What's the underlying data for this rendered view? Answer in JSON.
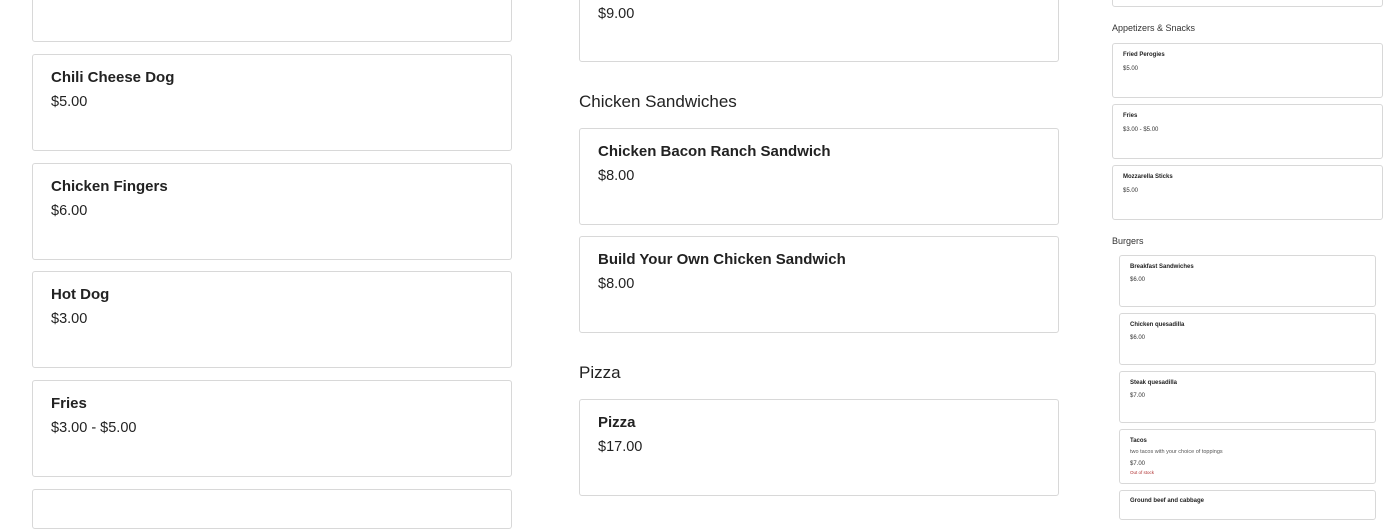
{
  "left_column": {
    "items": [
      {
        "name": "Chili Cheese Dog",
        "price": "$5.00"
      },
      {
        "name": "Chicken Fingers",
        "price": "$6.00"
      },
      {
        "name": "Hot Dog",
        "price": "$3.00"
      },
      {
        "name": "Fries",
        "price": "$3.00 - $5.00"
      }
    ]
  },
  "middle_column": {
    "top_price": "$9.00",
    "sections": [
      {
        "title": "Chicken Sandwiches",
        "items": [
          {
            "name": "Chicken Bacon Ranch Sandwich",
            "price": "$8.00"
          },
          {
            "name": "Build Your Own Chicken Sandwich",
            "price": "$8.00"
          }
        ]
      },
      {
        "title": "Pizza",
        "items": [
          {
            "name": "Pizza",
            "price": "$17.00"
          }
        ]
      }
    ]
  },
  "right_column": {
    "sections": [
      {
        "title": "Appetizers & Snacks",
        "items": [
          {
            "name": "Fried Perogies",
            "price": "$5.00"
          },
          {
            "name": "Fries",
            "price": "$3.00 - $5.00"
          },
          {
            "name": "Mozzarella Sticks",
            "price": "$5.00"
          }
        ]
      },
      {
        "title": "Burgers",
        "items": [
          {
            "name": "Breakfast Sandwiches",
            "price": "$6.00"
          },
          {
            "name": "Chicken quesadilla",
            "price": "$6.00"
          },
          {
            "name": "Steak quesadilla",
            "price": "$7.00"
          },
          {
            "name": "Tacos",
            "description": "two tacos with your choice of toppings",
            "price": "$7.00",
            "status": "Out of stock"
          },
          {
            "name": "Ground beef and cabbage"
          }
        ]
      }
    ]
  }
}
